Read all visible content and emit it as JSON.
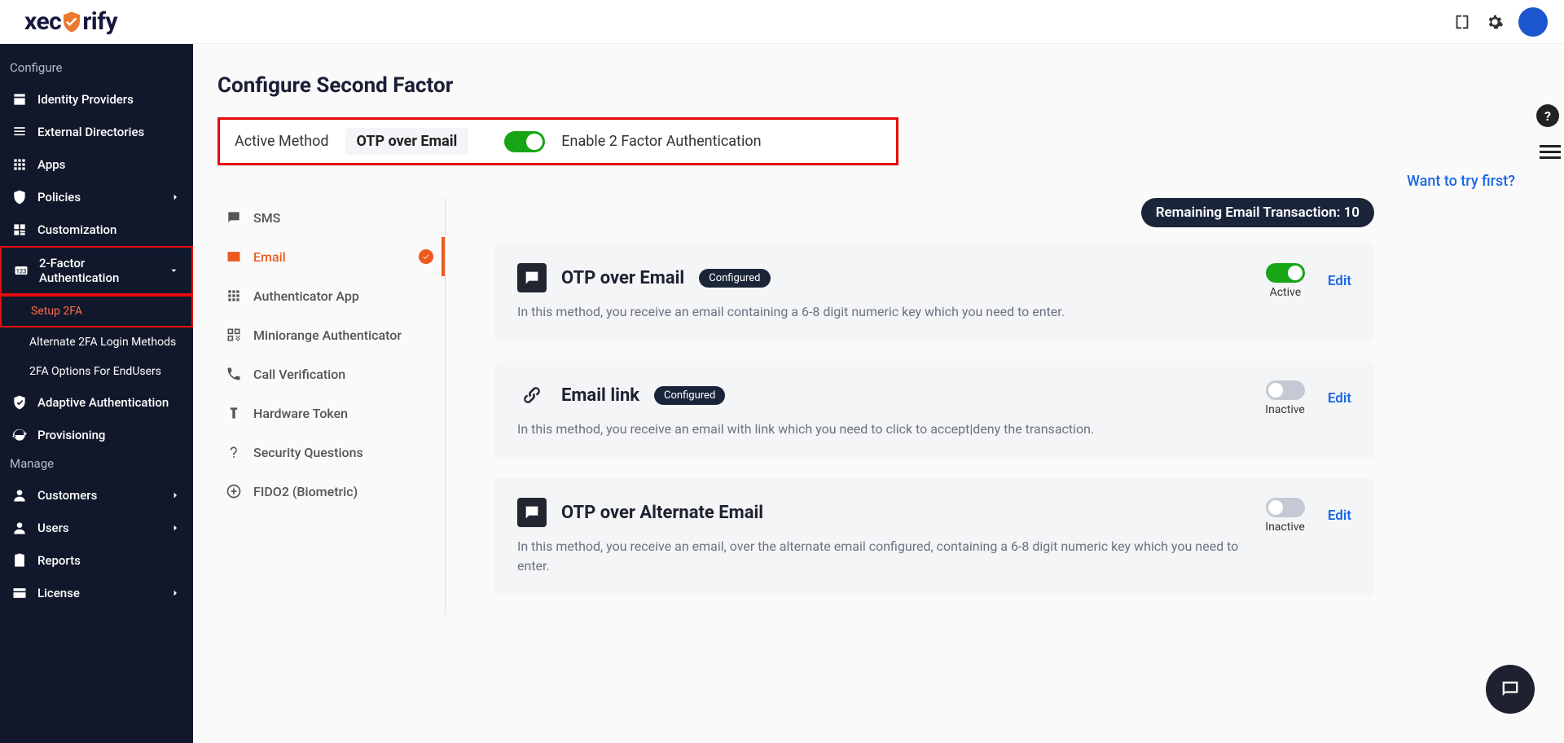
{
  "brand": "xecurify",
  "sidebar": {
    "sections": [
      {
        "heading": "Configure",
        "items": [
          {
            "label": "Identity Providers",
            "icon": "id"
          },
          {
            "label": "External Directories",
            "icon": "list"
          },
          {
            "label": "Apps",
            "icon": "apps"
          },
          {
            "label": "Policies",
            "icon": "shield",
            "chevron": true
          },
          {
            "label": "Customization",
            "icon": "custom"
          },
          {
            "label": "2-Factor Authentication",
            "icon": "2fa",
            "chevron": true,
            "expanded": true,
            "highlight": true,
            "children": [
              {
                "label": "Setup 2FA",
                "highlight": true
              },
              {
                "label": "Alternate 2FA Login Methods"
              },
              {
                "label": "2FA Options For EndUsers"
              }
            ]
          },
          {
            "label": "Adaptive Authentication",
            "icon": "shieldcheck"
          },
          {
            "label": "Provisioning",
            "icon": "sync"
          }
        ]
      },
      {
        "heading": "Manage",
        "items": [
          {
            "label": "Customers",
            "icon": "person",
            "chevron": true
          },
          {
            "label": "Users",
            "icon": "person",
            "chevron": true
          },
          {
            "label": "Reports",
            "icon": "clip"
          },
          {
            "label": "License",
            "icon": "card",
            "chevron": true
          }
        ]
      }
    ]
  },
  "page": {
    "title": "Configure Second Factor",
    "active_method_label": "Active Method",
    "active_method_value": "OTP over Email",
    "enable_label": "Enable 2 Factor Authentication",
    "enable_toggle": true,
    "want_link": "Want to try first?",
    "remaining_label": "Remaining Email Transaction: 10"
  },
  "tabs": [
    {
      "label": "SMS",
      "icon": "sms"
    },
    {
      "label": "Email",
      "icon": "email",
      "active": true,
      "checked": true
    },
    {
      "label": "Authenticator App",
      "icon": "grid"
    },
    {
      "label": "Miniorange Authenticator",
      "icon": "qr"
    },
    {
      "label": "Call Verification",
      "icon": "call"
    },
    {
      "label": "Hardware Token",
      "icon": "token"
    },
    {
      "label": "Security Questions",
      "icon": "question"
    },
    {
      "label": "FIDO2 (Biometric)",
      "icon": "globe"
    }
  ],
  "methods": [
    {
      "title": "OTP over Email",
      "badge": "Configured",
      "desc": "In this method, you receive an email containing a 6-8 digit numeric key which you need to enter.",
      "active": true,
      "status": "Active",
      "edit": "Edit",
      "icon": "chat"
    },
    {
      "title": "Email link",
      "badge": "Configured",
      "desc": "In this method, you receive an email with link which you need to click to accept|deny the transaction.",
      "active": false,
      "status": "Inactive",
      "edit": "Edit",
      "icon": "link"
    },
    {
      "title": "OTP over Alternate Email",
      "badge": null,
      "desc": "In this method, you receive an email, over the alternate email configured, containing a 6-8 digit numeric key which you need to enter.",
      "active": false,
      "status": "Inactive",
      "edit": "Edit",
      "icon": "chat"
    }
  ]
}
